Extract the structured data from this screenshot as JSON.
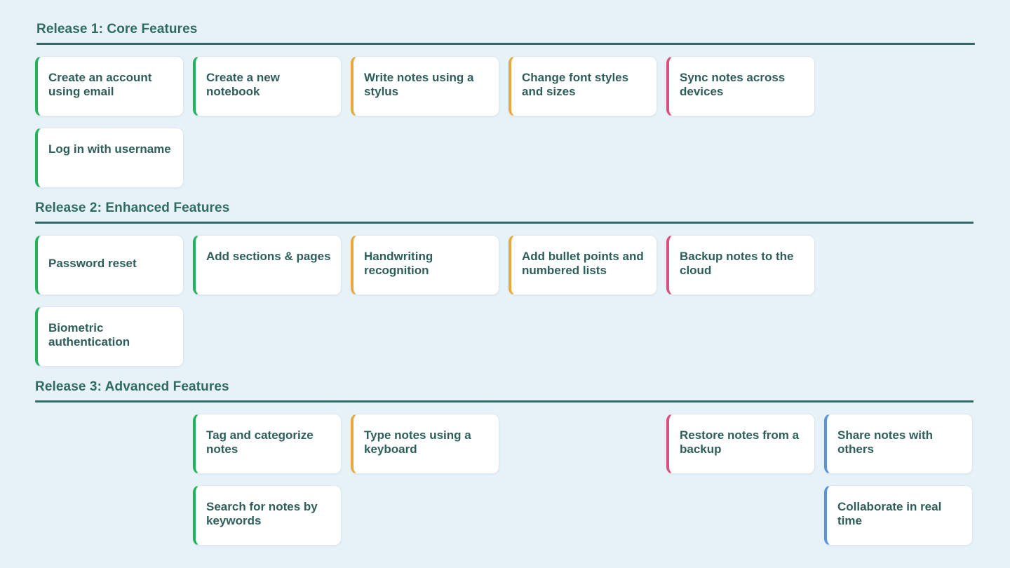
{
  "colors": {
    "background": "#e6f1f8",
    "heading": "#2f6b63",
    "rule": "#2f6b66",
    "card_text": "#2e5e5a",
    "green": "#22b35a",
    "orange": "#e8a93a",
    "pink": "#d9507a",
    "blue": "#5a93d8"
  },
  "releases": [
    {
      "title": "Release 1: Core Features",
      "cards": [
        {
          "label": "Create an account using email",
          "color": "green",
          "column": 1,
          "row": 1
        },
        {
          "label": "Create a new notebook",
          "color": "green",
          "column": 2,
          "row": 1
        },
        {
          "label": "Write notes using a stylus",
          "color": "orange",
          "column": 3,
          "row": 1
        },
        {
          "label": "Change font styles and sizes",
          "color": "orange",
          "column": 4,
          "row": 1
        },
        {
          "label": "Sync notes across devices",
          "color": "pink",
          "column": 5,
          "row": 1
        },
        {
          "label": "Log in with username",
          "color": "green",
          "column": 1,
          "row": 2
        }
      ]
    },
    {
      "title": "Release 2: Enhanced Features",
      "cards": [
        {
          "label": "Password reset",
          "color": "green",
          "column": 1,
          "row": 1
        },
        {
          "label": "Add sections & pages",
          "color": "green",
          "column": 2,
          "row": 1
        },
        {
          "label": "Handwriting recognition",
          "color": "orange",
          "column": 3,
          "row": 1
        },
        {
          "label": "Add bullet points and numbered lists",
          "color": "orange",
          "column": 4,
          "row": 1
        },
        {
          "label": "Backup notes to the cloud",
          "color": "pink",
          "column": 5,
          "row": 1
        },
        {
          "label": "Biometric authentication",
          "color": "green",
          "column": 1,
          "row": 2
        }
      ]
    },
    {
      "title": "Release 3: Advanced Features",
      "cards": [
        {
          "label": "Tag and categorize notes",
          "color": "green",
          "column": 2,
          "row": 1
        },
        {
          "label": "Type notes using a keyboard",
          "color": "orange",
          "column": 3,
          "row": 1
        },
        {
          "label": "Restore notes from a backup",
          "color": "pink",
          "column": 5,
          "row": 1
        },
        {
          "label": "Share notes with others",
          "color": "blue",
          "column": 6,
          "row": 1
        },
        {
          "label": "Search for notes by keywords",
          "color": "green",
          "column": 2,
          "row": 2
        },
        {
          "label": "Collaborate in real time",
          "color": "blue",
          "column": 6,
          "row": 2
        }
      ]
    }
  ]
}
